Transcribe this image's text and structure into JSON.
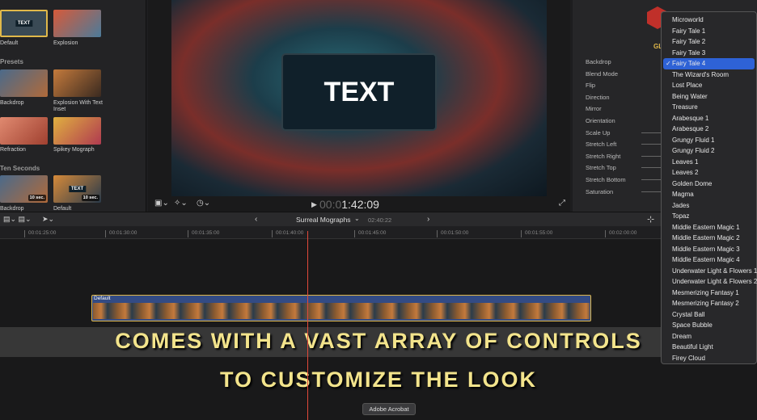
{
  "browser": {
    "items": [
      {
        "label": "Default"
      },
      {
        "label": "Explosion"
      },
      {
        "label": "Backdrop"
      },
      {
        "label": "Explosion With Text Inset"
      },
      {
        "label": "Refraction"
      },
      {
        "label": "Spikey Mograph"
      },
      {
        "label": "Backdrop"
      },
      {
        "label": "Default"
      }
    ],
    "sections": [
      "Presets",
      "Ten Seconds"
    ],
    "thumb_text": "TEXT",
    "badge": "10 sec."
  },
  "viewer": {
    "overlay_text": "TEXT",
    "timecode_dim": "00:0",
    "timecode": "1:42:09"
  },
  "inspector": {
    "title": "GL",
    "params": [
      "Backdrop",
      "Blend Mode",
      "Flip",
      "Direction",
      "Mirror",
      "Orientation",
      "Scale Up",
      "Stretch Left",
      "Stretch Right",
      "Stretch Top",
      "Stretch Bottom",
      "Saturation"
    ]
  },
  "timeline": {
    "project": "Surreal Mographs",
    "duration": "02:40:22",
    "ruler": [
      "00:01:25:00",
      "00:01:30:00",
      "00:01:35:00",
      "00:01:40:00",
      "00:01:45:00",
      "00:01:50:00",
      "00:01:55:00",
      "00:02:00:00"
    ],
    "clip_label": "Default"
  },
  "captions": [
    "COMES WITH A VAST ARRAY OF CONTROLS",
    "TO CUSTOMIZE THE LOOK"
  ],
  "tooltip": "Adobe Acrobat",
  "menu": {
    "selected": "Fairy Tale 4",
    "check": "✓",
    "items": [
      "Microworld",
      "Fairy Tale 1",
      "Fairy Tale 2",
      "Fairy Tale 3",
      "Fairy Tale 4",
      "The Wizard's Room",
      "Lost Place",
      "Being Water",
      "Treasure",
      "Arabesque 1",
      "Arabesque 2",
      "Grungy Fluid 1",
      "Grungy Fluid 2",
      "Leaves 1",
      "Leaves 2",
      "Golden Dome",
      "Magma",
      "Jades",
      "Topaz",
      "Middle Eastern Magic 1",
      "Middle Eastern Magic 2",
      "Middle Eastern Magic 3",
      "Middle Eastern Magic 4",
      "Underwater Light & Flowers 1",
      "Underwater Light & Flowers 2",
      "Mesmerizing Fantasy 1",
      "Mesmerizing Fantasy 2",
      "Crystal Ball",
      "Space Bubble",
      "Dream",
      "Beautiful Light",
      "Firey Cloud"
    ]
  },
  "colors": {
    "accent": "#2e62d6",
    "caption": "#f3e48c",
    "playhead": "#e2493a"
  }
}
